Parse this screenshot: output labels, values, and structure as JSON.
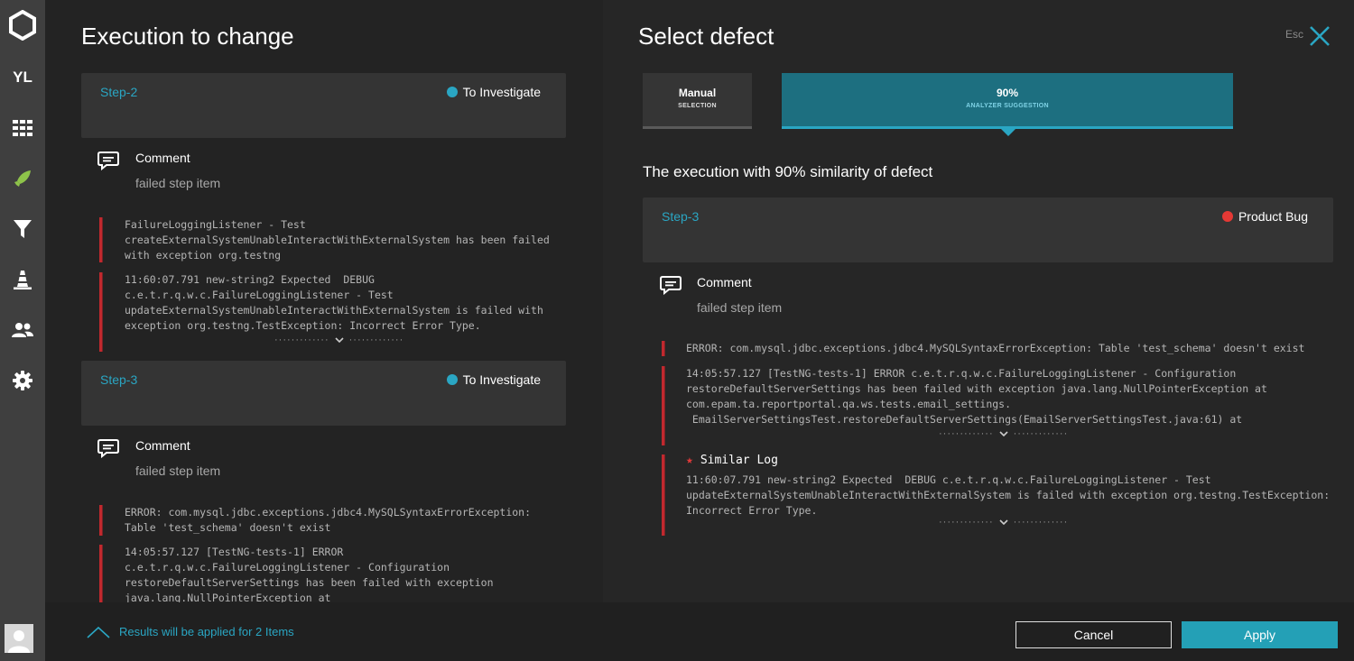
{
  "sidebar": {
    "user_initials": "YL"
  },
  "left": {
    "title": "Execution to change",
    "steps": [
      {
        "name": "Step-2",
        "status": "To Investigate",
        "comment_label": "Comment",
        "comment_text": "failed step item",
        "logs": [
          "FailureLoggingListener - Test\ncreateExternalSystemUnableInteractWithExternalSystem has been failed\nwith exception org.testng",
          "11:60:07.791 new-string2 Expected  DEBUG\nc.e.t.r.q.w.c.FailureLoggingListener - Test\nupdateExternalSystemUnableInteractWithExternalSystem is failed with\nexception org.testng.TestException: Incorrect Error Type."
        ]
      },
      {
        "name": "Step-3",
        "status": "To Investigate",
        "comment_label": "Comment",
        "comment_text": "failed step item",
        "logs": [
          "ERROR: com.mysql.jdbc.exceptions.jdbc4.MySQLSyntaxErrorException:\nTable 'test_schema' doesn't exist",
          "14:05:57.127 [TestNG-tests-1] ERROR\nc.e.t.r.q.w.c.FailureLoggingListener - Configuration\nrestoreDefaultServerSettings has been failed with exception\njava.lang.NullPointerException at"
        ]
      }
    ]
  },
  "right": {
    "title": "Select defect",
    "esc_label": "Esc",
    "tabs": [
      {
        "title": "Manual",
        "subtitle": "SELECTION"
      },
      {
        "title": "90%",
        "subtitle": "ANALYZER SUGGESTION"
      }
    ],
    "heading": "The execution with 90% similarity of defect",
    "step": {
      "name": "Step-3",
      "status": "Product Bug",
      "comment_label": "Comment",
      "comment_text": "failed step item",
      "logs": [
        "ERROR: com.mysql.jdbc.exceptions.jdbc4.MySQLSyntaxErrorException: Table 'test_schema' doesn't exist",
        "14:05:57.127 [TestNG-tests-1] ERROR c.e.t.r.q.w.c.FailureLoggingListener - Configuration\nrestoreDefaultServerSettings has been failed with exception java.lang.NullPointerException at\ncom.epam.ta.reportportal.qa.ws.tests.email_settings.\n EmailServerSettingsTest.restoreDefaultServerSettings(EmailServerSettingsTest.java:61) at"
      ],
      "similar_label": "Similar Log",
      "similar_log": "11:60:07.791 new-string2 Expected  DEBUG c.e.t.r.q.w.c.FailureLoggingListener - Test\nupdateExternalSystemUnableInteractWithExternalSystem is failed with exception org.testng.TestException:\nIncorrect Error Type."
    }
  },
  "footer": {
    "results_text": "Results will be applied for 2 Items",
    "cancel_label": "Cancel",
    "apply_label": "Apply"
  },
  "colors": {
    "accent": "#2aa6c3",
    "to_investigate": "#2aa6c3",
    "product_bug": "#e53935",
    "log_error_bar": "#c1292e"
  }
}
